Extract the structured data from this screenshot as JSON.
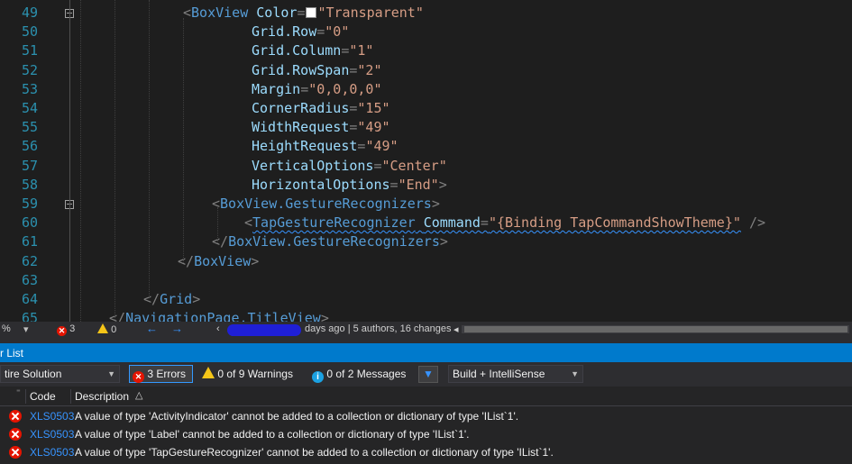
{
  "editor": {
    "lines": [
      {
        "num": "49",
        "segments": [
          [
            "tag",
            "<"
          ],
          [
            "el",
            "BoxView"
          ],
          [
            "plain",
            " "
          ],
          [
            "attr",
            "Color"
          ],
          [
            "pun",
            "="
          ],
          [
            "swatch",
            ""
          ],
          [
            "str",
            "\"Transparent\""
          ]
        ]
      },
      {
        "num": "50",
        "segments": [
          [
            "attr",
            "Grid.Row"
          ],
          [
            "pun",
            "="
          ],
          [
            "str",
            "\"0\""
          ]
        ]
      },
      {
        "num": "51",
        "segments": [
          [
            "attr",
            "Grid.Column"
          ],
          [
            "pun",
            "="
          ],
          [
            "str",
            "\"1\""
          ]
        ]
      },
      {
        "num": "52",
        "segments": [
          [
            "attr",
            "Grid.RowSpan"
          ],
          [
            "pun",
            "="
          ],
          [
            "str",
            "\"2\""
          ]
        ]
      },
      {
        "num": "53",
        "segments": [
          [
            "attr",
            "Margin"
          ],
          [
            "pun",
            "="
          ],
          [
            "str",
            "\"0,0,0,0\""
          ]
        ]
      },
      {
        "num": "54",
        "segments": [
          [
            "attr",
            "CornerRadius"
          ],
          [
            "pun",
            "="
          ],
          [
            "str",
            "\"15\""
          ]
        ]
      },
      {
        "num": "55",
        "segments": [
          [
            "attr",
            "WidthRequest"
          ],
          [
            "pun",
            "="
          ],
          [
            "str",
            "\"49\""
          ]
        ]
      },
      {
        "num": "56",
        "segments": [
          [
            "attr",
            "HeightRequest"
          ],
          [
            "pun",
            "="
          ],
          [
            "str",
            "\"49\""
          ]
        ]
      },
      {
        "num": "57",
        "segments": [
          [
            "attr",
            "VerticalOptions"
          ],
          [
            "pun",
            "="
          ],
          [
            "str",
            "\"Center\""
          ]
        ]
      },
      {
        "num": "58",
        "segments": [
          [
            "attr",
            "HorizontalOptions"
          ],
          [
            "pun",
            "="
          ],
          [
            "str",
            "\"End\""
          ],
          [
            "tag",
            ">"
          ]
        ]
      },
      {
        "num": "59",
        "segments": [
          [
            "tag",
            "<"
          ],
          [
            "el",
            "BoxView.GestureRecognizers"
          ],
          [
            "tag",
            ">"
          ]
        ]
      },
      {
        "num": "60",
        "segments": [
          [
            "tag",
            "<"
          ],
          [
            "el",
            "TapGestureRecognizer"
          ],
          [
            "plain",
            " "
          ],
          [
            "attr",
            "Command"
          ],
          [
            "pun",
            "="
          ],
          [
            "str",
            "\"{Binding TapCommandShowTheme}\""
          ],
          [
            "plain",
            " "
          ],
          [
            "tag",
            "/>"
          ]
        ]
      },
      {
        "num": "61",
        "segments": [
          [
            "tag",
            "</"
          ],
          [
            "el",
            "BoxView.GestureRecognizers"
          ],
          [
            "tag",
            ">"
          ]
        ]
      },
      {
        "num": "62",
        "segments": [
          [
            "tag",
            "</"
          ],
          [
            "el",
            "BoxView"
          ],
          [
            "tag",
            ">"
          ]
        ]
      },
      {
        "num": "63",
        "segments": []
      },
      {
        "num": "64",
        "segments": [
          [
            "tag",
            "</"
          ],
          [
            "el",
            "Grid"
          ],
          [
            "tag",
            ">"
          ]
        ]
      },
      {
        "num": "65",
        "segments": [
          [
            "tag",
            "</"
          ],
          [
            "el",
            "NavigationPage.TitleView"
          ],
          [
            "tag",
            ">"
          ]
        ]
      }
    ]
  },
  "statusbar": {
    "zoom": "%",
    "errors_count": "3",
    "warnings_count": "0",
    "nav_back": "←",
    "nav_forward": "→",
    "codelens_prefix": "‹",
    "codelens_text": "days ago | 5 authors, 16 changes",
    "scroll_left": "◂"
  },
  "error_list": {
    "title": "r List",
    "scope": "tire Solution",
    "errors_btn": "3 Errors",
    "warnings_btn": "0 of 9 Warnings",
    "messages_btn": "0 of 2 Messages",
    "build_filter": "Build + IntelliSense",
    "columns": {
      "code": "Code",
      "description": "Description"
    },
    "rows": [
      {
        "code": "XLS0503",
        "description": "A value of type 'ActivityIndicator' cannot be added to a collection or dictionary of type 'IList`1'."
      },
      {
        "code": "XLS0503",
        "description": "A value of type 'Label' cannot be added to a collection or dictionary of type 'IList`1'."
      },
      {
        "code": "XLS0503",
        "description": "A value of type 'TapGestureRecognizer' cannot be added to a collection or dictionary of type 'IList`1'."
      }
    ],
    "colors": {
      "accent": "#007acc",
      "error": "#e51400",
      "link": "#3794ff"
    }
  }
}
